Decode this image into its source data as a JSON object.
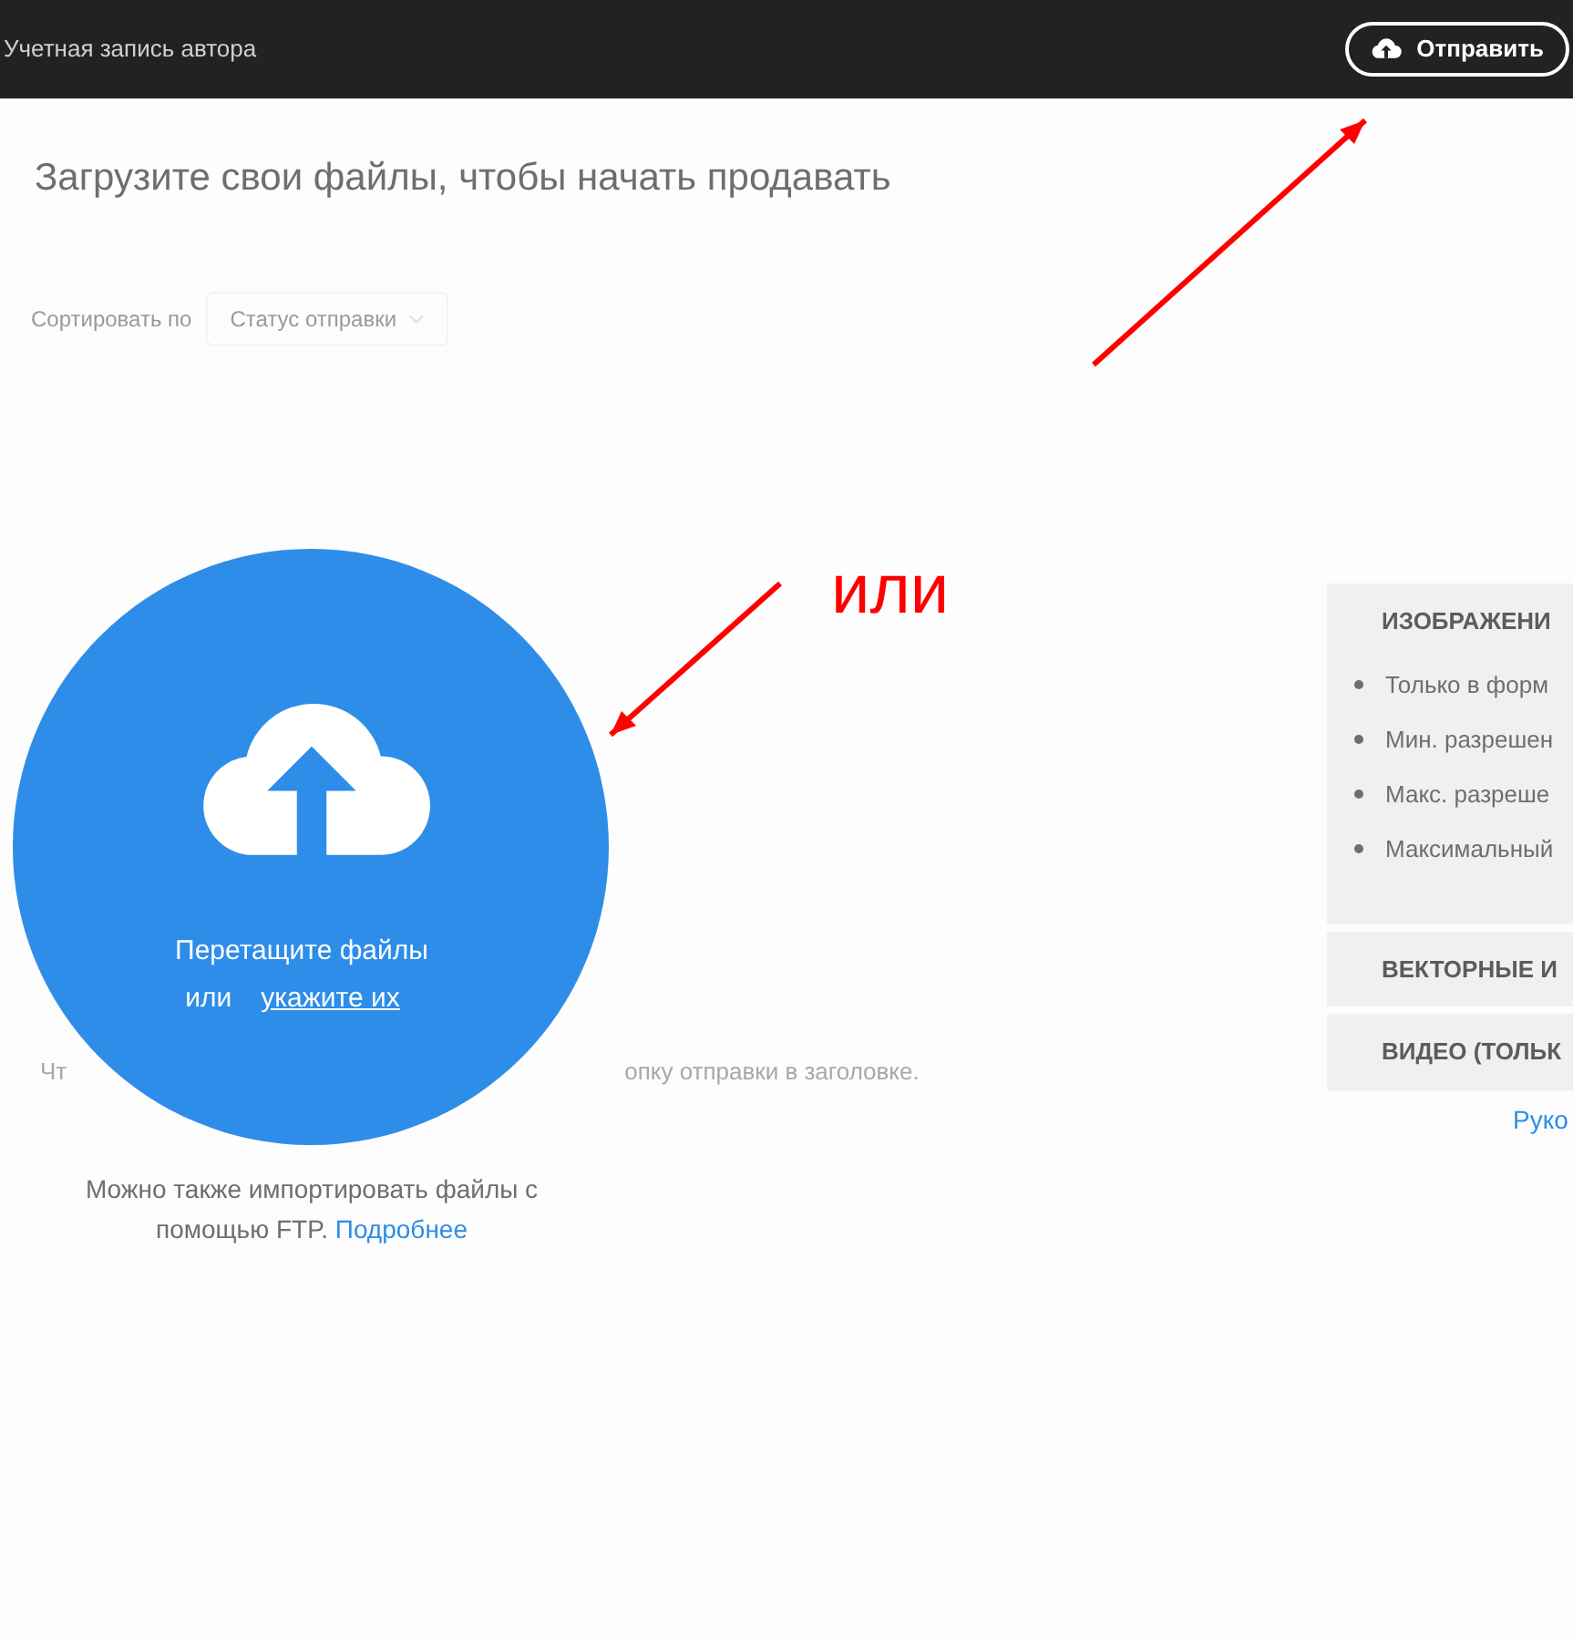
{
  "header": {
    "account_link": "Учетная запись автора",
    "upload_button": "Отправить"
  },
  "page_title": "Загрузите свои файлы, чтобы начать продавать",
  "sort": {
    "label": "Сортировать по",
    "value": "Статус отправки"
  },
  "dropzone": {
    "line_1": "Перетащите файлы",
    "or_text": "или",
    "browse_link": "укажите их"
  },
  "hint_fragments": [
    "Чт",
    "опку отправки в заголовке."
  ],
  "ftp_note": {
    "text": "Можно также импортировать файлы с помощью FTP.",
    "link": "Подробнее"
  },
  "requirements": {
    "sections": [
      {
        "title": "ИЗОБРАЖЕНИ",
        "expanded": true,
        "items": [
          "Только в форм",
          "Мин. разрешен",
          "Макс. разреше",
          "Максимальный"
        ]
      },
      {
        "title": "ВЕКТОРНЫЕ И",
        "expanded": false
      },
      {
        "title": "ВИДЕО (ТОЛЬК",
        "expanded": false
      }
    ],
    "link": "Руко"
  },
  "annotation": {
    "label": "или"
  }
}
